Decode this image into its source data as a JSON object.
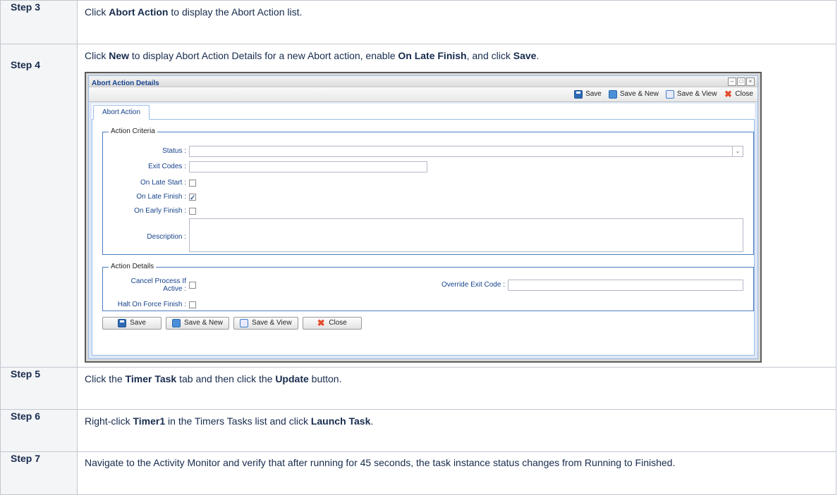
{
  "steps": [
    {
      "label": "Step 3",
      "parts": [
        "Click ",
        "Abort Action",
        " to display the Abort Action list."
      ]
    },
    {
      "label": "Step 4",
      "parts": [
        "Click ",
        "New",
        " to display Abort Action Details for a new Abort action, enable ",
        "On Late Finish",
        ", and click ",
        "Save",
        "."
      ]
    },
    {
      "label": "Step 5",
      "parts": [
        "Click the ",
        "Timer Task",
        " tab and then click the ",
        "Update",
        " button."
      ]
    },
    {
      "label": "Step 6",
      "parts": [
        "Right-click ",
        "Timer1",
        " in the Timers Tasks list and click ",
        "Launch Task",
        "."
      ]
    },
    {
      "label": "Step 7",
      "text": "Navigate to the Activity Monitor and verify that after running for 45 seconds, the task instance status changes from Running to Finished."
    }
  ],
  "dialog": {
    "title": "Abort Action Details",
    "window_buttons": [
      "–",
      "□",
      "×"
    ],
    "toolbar": {
      "save": "Save",
      "save_new": "Save & New",
      "save_view": "Save & View",
      "close": "Close"
    },
    "tab": "Abort Action",
    "criteria": {
      "legend": "Action Criteria",
      "status_label": "Status :",
      "status_value": "",
      "exit_codes_label": "Exit Codes :",
      "exit_codes_value": "",
      "on_late_start_label": "On Late Start :",
      "on_late_start": false,
      "on_late_finish_label": "On Late Finish :",
      "on_late_finish": true,
      "on_early_finish_label": "On Early Finish :",
      "on_early_finish": false,
      "description_label": "Description :",
      "description_value": ""
    },
    "details": {
      "legend": "Action Details",
      "cancel_process_label_1": "Cancel Process If",
      "cancel_process_label_2": "Active :",
      "cancel_process": false,
      "halt_label": "Halt On Force Finish :",
      "halt": false,
      "override_label": "Override Exit Code :",
      "override_value": ""
    },
    "bottom_buttons": {
      "save": "Save",
      "save_new": "Save & New",
      "save_view": "Save & View",
      "close": "Close"
    },
    "icons": {
      "save": "save-disk-icon",
      "save_new": "save-new-icon",
      "save_view": "save-view-icon",
      "close": "close-x-icon"
    }
  }
}
